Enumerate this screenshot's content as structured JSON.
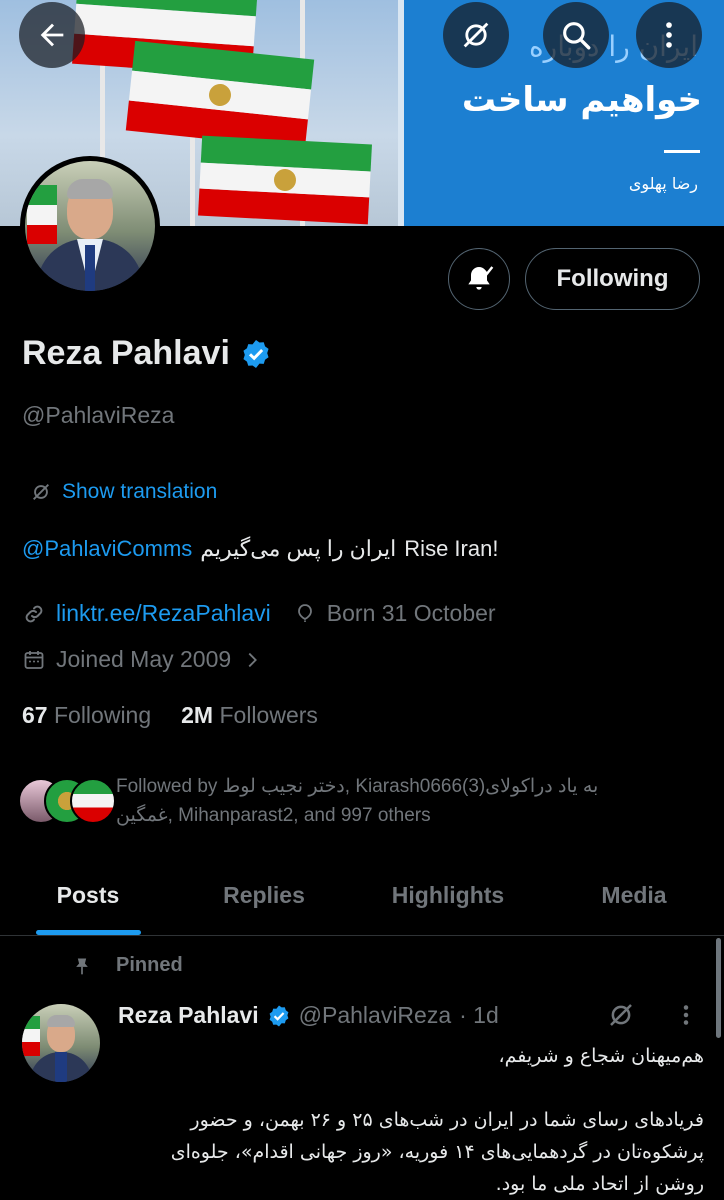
{
  "banner": {
    "line1": "ایران را دوباره",
    "line2": "خواهیم ساخت",
    "signature": "رضا پهلوی"
  },
  "header_icons": [
    "back-arrow-icon",
    "translate-icon",
    "search-icon",
    "more-icon"
  ],
  "profile": {
    "name": "Reza Pahlavi",
    "handle": "@PahlaviReza",
    "following_button": "Following",
    "show_translation": "Show translation",
    "bio_mention": "@PahlaviComms",
    "bio_fa": "ایران را پس می‌گیریم",
    "bio_en": "Rise Iran!",
    "link": "linktr.ee/RezaPahlavi",
    "born": "Born 31 October",
    "joined": "Joined May 2009",
    "following_count": "67",
    "following_label": "Following",
    "followers_count": "2M",
    "followers_label": "Followers",
    "followed_by_line1": "Followed by دختر نجیب لوط, Kiarash0666(3)به یاد دراکولای",
    "followed_by_line2": "غمگین, Mihanparast2, and 997 others"
  },
  "tabs": [
    {
      "label": "Posts",
      "active": true
    },
    {
      "label": "Replies",
      "active": false
    },
    {
      "label": "Highlights",
      "active": false
    },
    {
      "label": "Media",
      "active": false
    }
  ],
  "post": {
    "pinned_label": "Pinned",
    "author": "Reza Pahlavi",
    "handle": "@PahlaviReza",
    "time": "· 1d",
    "para1": "هم‌میهنان شجاع و شریفم،",
    "para2": "فریادهای رسای شما در ایران در شب‌های ۲۵ و ۲۶ بهمن، و حضور پرشکوه‌تان در گردهمایی‌های ۱۴ فوریه، «روز جهانی اقدام»، جلوه‌ای روشن از اتحاد ملی ما بود."
  },
  "colors": {
    "accent": "#1d9bf0",
    "muted": "#71767b",
    "text": "#e7e9ea",
    "border": "#2f3336",
    "verified": "#1d9bf0"
  }
}
